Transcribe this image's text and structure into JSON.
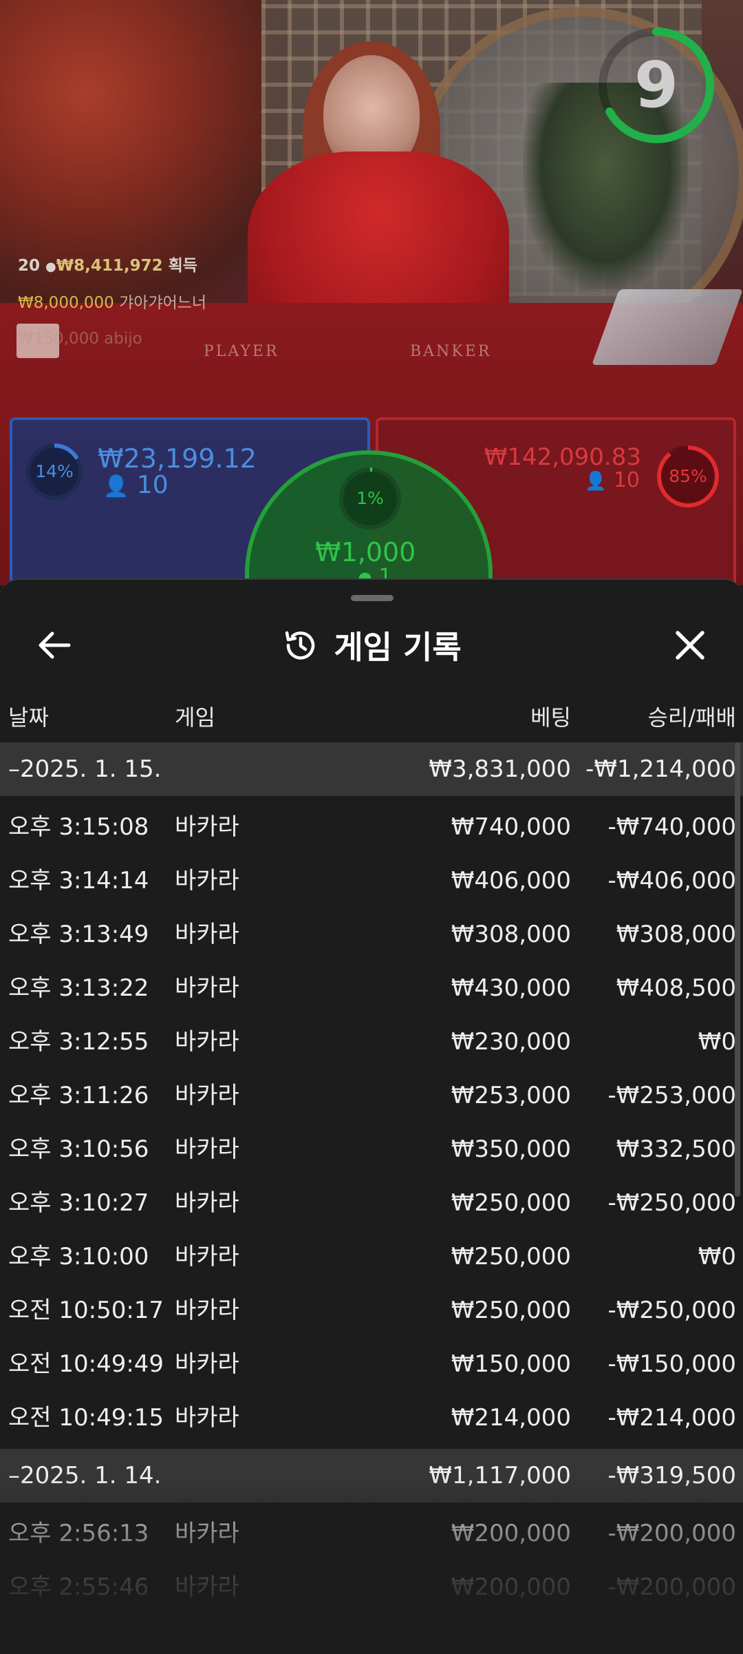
{
  "video": {
    "timer": "9",
    "felt_labels": {
      "player": "PLAYER",
      "banker": "BANKER"
    },
    "winners": {
      "line1_count": "20",
      "line1_amount": "₩8,411,972",
      "line1_suffix": "획득",
      "line2_amount": "₩8,000,000",
      "line2_name": "갸아갸어느너",
      "line3": "₩150,000 abijo"
    },
    "player": {
      "percent": "14%",
      "amount": "₩23,199.12",
      "players": "10"
    },
    "banker": {
      "percent": "85%",
      "amount": "₩142,090.83",
      "players": "10"
    },
    "tie": {
      "percent": "1%",
      "amount": "₩1,000",
      "players": "1"
    },
    "colors": {
      "player": "#2d5ab8",
      "banker": "#b8262e",
      "tie": "#24a03a",
      "timer_ring": "#22b04a"
    }
  },
  "sheet": {
    "title": "게임 기록",
    "history_icon": "history-icon",
    "back_icon": "arrow-left-icon",
    "close_icon": "close-icon",
    "columns": {
      "date": "날짜",
      "game": "게임",
      "bet": "베팅",
      "winloss": "승리/패배"
    },
    "days": [
      {
        "date": "–2025. 1. 15.",
        "bet_total": "₩3,831,000",
        "winloss_total": "-₩1,214,000",
        "rows": [
          {
            "time": "오후 3:15:08",
            "game": "바카라",
            "bet": "₩740,000",
            "winloss": "-₩740,000"
          },
          {
            "time": "오후 3:14:14",
            "game": "바카라",
            "bet": "₩406,000",
            "winloss": "-₩406,000"
          },
          {
            "time": "오후 3:13:49",
            "game": "바카라",
            "bet": "₩308,000",
            "winloss": "₩308,000"
          },
          {
            "time": "오후 3:13:22",
            "game": "바카라",
            "bet": "₩430,000",
            "winloss": "₩408,500"
          },
          {
            "time": "오후 3:12:55",
            "game": "바카라",
            "bet": "₩230,000",
            "winloss": "₩0"
          },
          {
            "time": "오후 3:11:26",
            "game": "바카라",
            "bet": "₩253,000",
            "winloss": "-₩253,000"
          },
          {
            "time": "오후 3:10:56",
            "game": "바카라",
            "bet": "₩350,000",
            "winloss": "₩332,500"
          },
          {
            "time": "오후 3:10:27",
            "game": "바카라",
            "bet": "₩250,000",
            "winloss": "-₩250,000"
          },
          {
            "time": "오후 3:10:00",
            "game": "바카라",
            "bet": "₩250,000",
            "winloss": "₩0"
          },
          {
            "time": "오전 10:50:17",
            "game": "바카라",
            "bet": "₩250,000",
            "winloss": "-₩250,000"
          },
          {
            "time": "오전 10:49:49",
            "game": "바카라",
            "bet": "₩150,000",
            "winloss": "-₩150,000"
          },
          {
            "time": "오전 10:49:15",
            "game": "바카라",
            "bet": "₩214,000",
            "winloss": "-₩214,000"
          }
        ]
      },
      {
        "date": "–2025. 1. 14.",
        "bet_total": "₩1,117,000",
        "winloss_total": "-₩319,500",
        "rows": [
          {
            "time": "오후 2:56:13",
            "game": "바카라",
            "bet": "₩200,000",
            "winloss": "-₩200,000"
          },
          {
            "time": "오후 2:55:46",
            "game": "바카라",
            "bet": "₩200,000",
            "winloss": "-₩200,000"
          }
        ]
      }
    ]
  }
}
